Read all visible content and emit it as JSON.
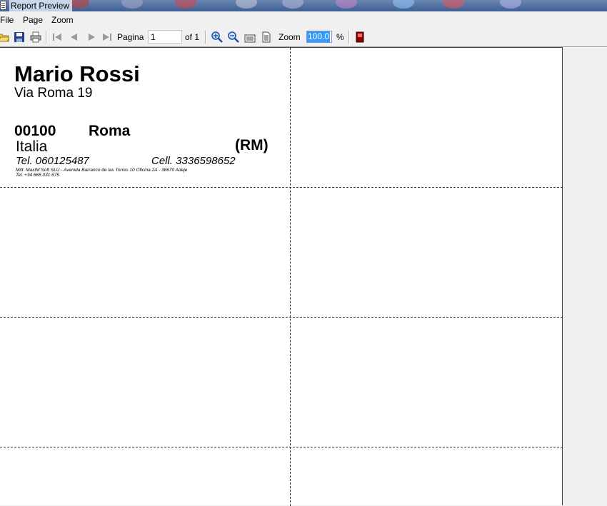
{
  "window": {
    "title": "Report Preview"
  },
  "menu": [
    "File",
    "Page",
    "Zoom"
  ],
  "toolbar": {
    "page_label": "Pagina",
    "page_value": "1",
    "of_label": "of 1",
    "zoom_label": "Zoom",
    "zoom_value": "100.0",
    "percent_label": "%",
    "icons": [
      "open-folder-icon",
      "save-icon",
      "print-icon",
      "first-page-icon",
      "prev-page-icon",
      "next-page-icon",
      "last-page-icon",
      "zoom-in-icon",
      "zoom-out-icon",
      "page-width-icon",
      "whole-page-icon",
      "close-icon"
    ]
  },
  "label": {
    "name": "Mario Rossi",
    "street": "Via Roma 19",
    "cap": "00100",
    "city": "Roma",
    "country": "Italia",
    "province": "(RM)",
    "tel": "Tel. 060125487",
    "cell": "Cell. 3336598652",
    "sender_line1": "Mitt: MaxIM Soft SLU - Avenida Barranco de las Torres 10 Oficina 2A - 38670 Adeje",
    "sender_line2": "Tel. +34 665 031 675"
  },
  "colors": {
    "accent": "#3399ff",
    "titlebar": "#4a6a9c"
  }
}
